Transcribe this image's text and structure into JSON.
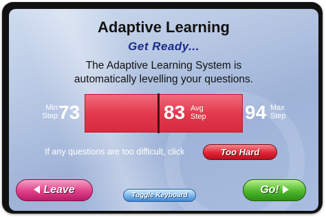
{
  "dialog": {
    "title": "Adaptive Learning",
    "subtitle": "Get Ready...",
    "description_line1": "The Adaptive Learning System is",
    "description_line2": "automatically levelling your questions."
  },
  "stats": {
    "min": {
      "label_line1": "Min",
      "label_line2": "Step",
      "value": "73"
    },
    "avg": {
      "label_line1": "Avg",
      "label_line2": "Step",
      "value": "83"
    },
    "max": {
      "label_line1": "Max",
      "label_line2": "Step",
      "value": "94"
    }
  },
  "hint": {
    "text": "If any questions are too difficult, click",
    "too_hard_label": "Too Hard"
  },
  "buttons": {
    "leave_label": "Leave",
    "toggle_keyboard_label": "Toggle Keyboard",
    "go_label": "Go!"
  },
  "icons": {
    "leave": "arrow-left-icon",
    "go": "arrow-right-icon"
  },
  "colors": {
    "bar": "#e23a4e",
    "subtitle": "#1b2a8a",
    "leave_button": "#e04089",
    "go_button": "#4fb82c",
    "too_hard_button": "#e02534",
    "toggle_button": "#79b4ea"
  }
}
